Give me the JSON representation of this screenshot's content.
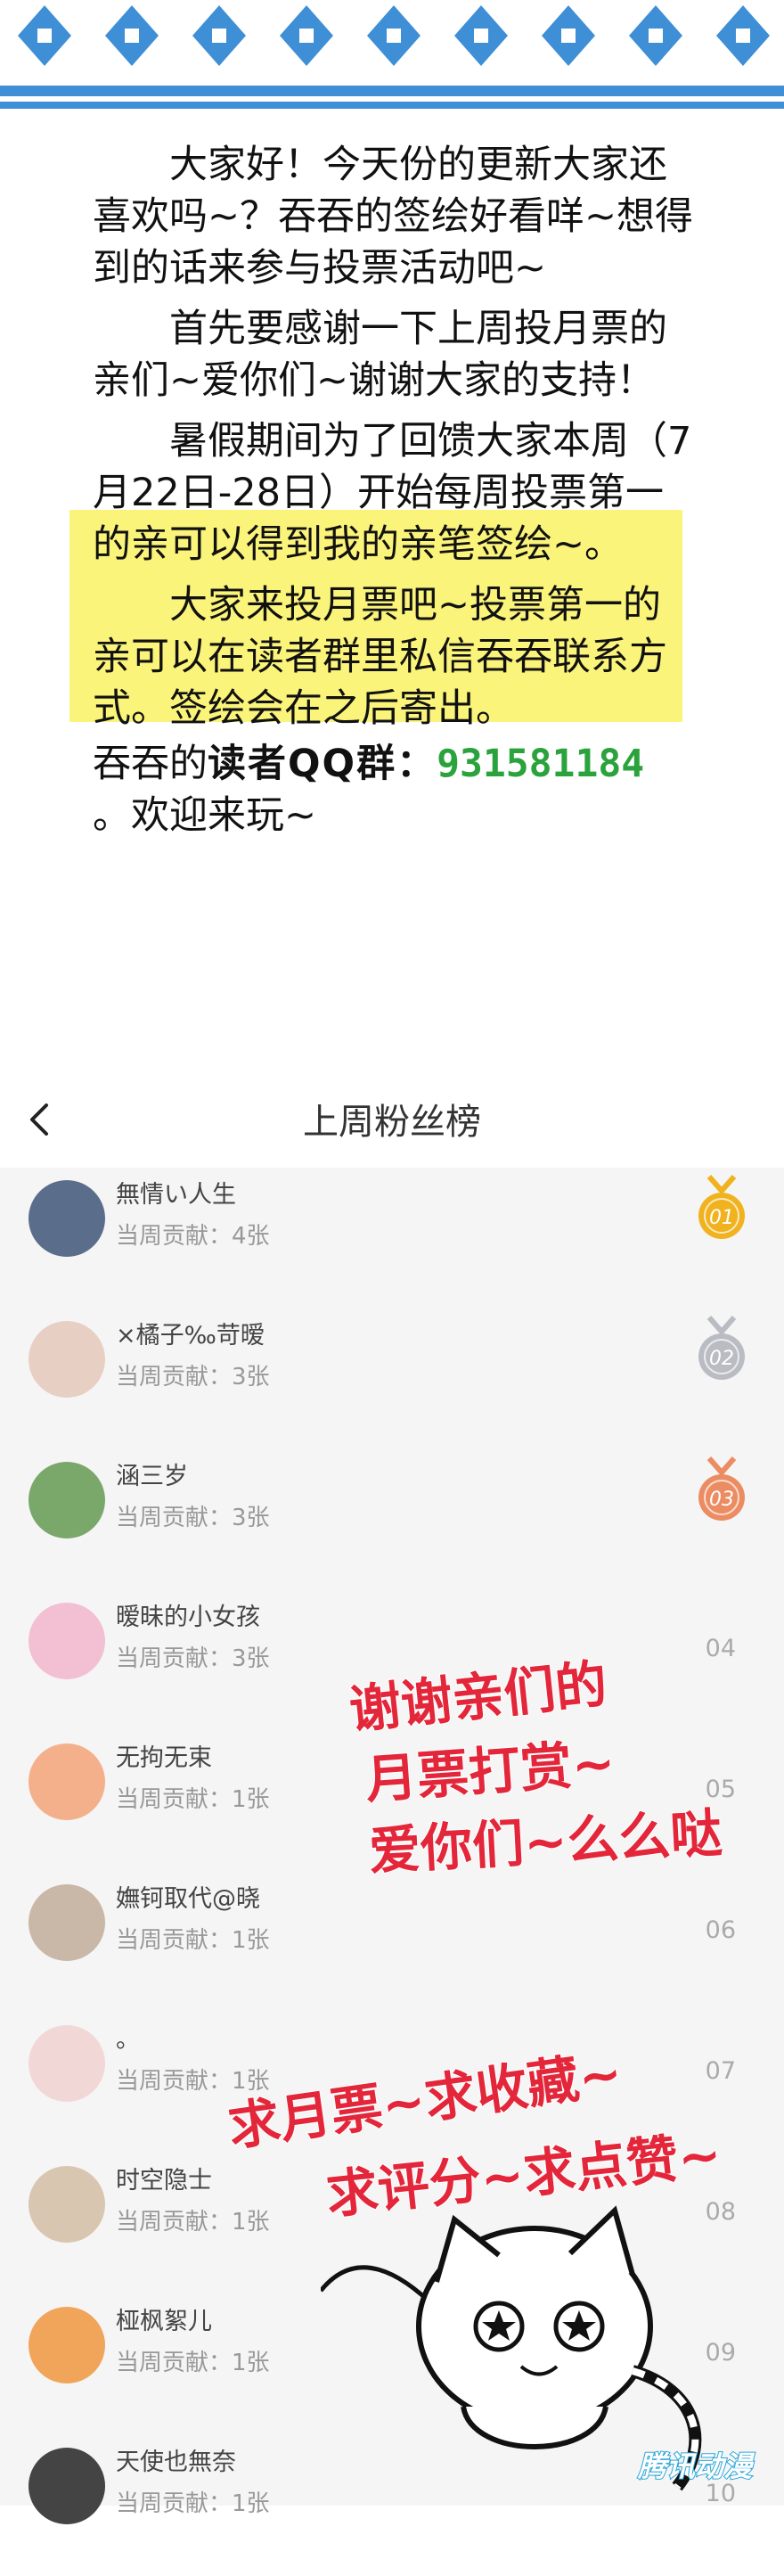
{
  "notice": {
    "paragraphs": [
      "　　大家好！今天份的更新大家还喜欢吗~？吞吞的签绘好看咩~想得到的话来参与投票活动吧~",
      "　　首先要感谢一下上周投月票的亲们~爱你们~谢谢大家的支持！",
      "　　暑假期间为了回馈大家本周（7月22日-28日）开始每周投票第一的亲可以得到我的亲笔签绘~。",
      "　　大家来投月票吧~投票第一的亲可以在读者群里私信吞吞联系方式。签绘会在之后寄出。"
    ],
    "qq_prefix": "吞吞的",
    "qq_label": "读者QQ群：",
    "qq_number": "931581184",
    "qq_suffix": "。欢迎来玩~"
  },
  "rank_panel": {
    "back_label": "<",
    "title": "上周粉丝榜",
    "fans": [
      {
        "name": "無情い人生",
        "contrib": "当周贡献：4张",
        "rank": "01"
      },
      {
        "name": "×橘子‰苛暧",
        "contrib": "当周贡献：3张",
        "rank": "02"
      },
      {
        "name": "涵三岁",
        "contrib": "当周贡献：3张",
        "rank": "03"
      },
      {
        "name": "暧昧的小女孩",
        "contrib": "当周贡献：3张",
        "rank": "04"
      },
      {
        "name": "无拘无束",
        "contrib": "当周贡献：1张",
        "rank": "05"
      },
      {
        "name": "嫵钶取代@晓",
        "contrib": "当周贡献：1张",
        "rank": "06"
      },
      {
        "name": "。",
        "contrib": "当周贡献：1张",
        "rank": "07"
      },
      {
        "name": "时空隐士",
        "contrib": "当周贡献：1张",
        "rank": "08"
      },
      {
        "name": "桠枫絮儿",
        "contrib": "当周贡献：1张",
        "rank": "09"
      },
      {
        "name": "天使也無奈",
        "contrib": "当周贡献：1张",
        "rank": "10"
      }
    ]
  },
  "overlay": {
    "thanks_line1": "谢谢亲们的",
    "thanks_line2": "月票打赏~",
    "thanks_line3": "爱你们~么么哒",
    "ask_line1": "求月票~求收藏~",
    "ask_line2": "求评分~求点赞~"
  },
  "watermark": "腾讯动漫",
  "colors": {
    "banner_blue": "#3f8fd6",
    "highlight": "#fbf47a",
    "qq_green": "#2aa33c",
    "overlay_red": "#e3263a",
    "medal_gold": "#f0b21e",
    "medal_silver": "#b9bcc2",
    "medal_bronze": "#ec8c62"
  }
}
